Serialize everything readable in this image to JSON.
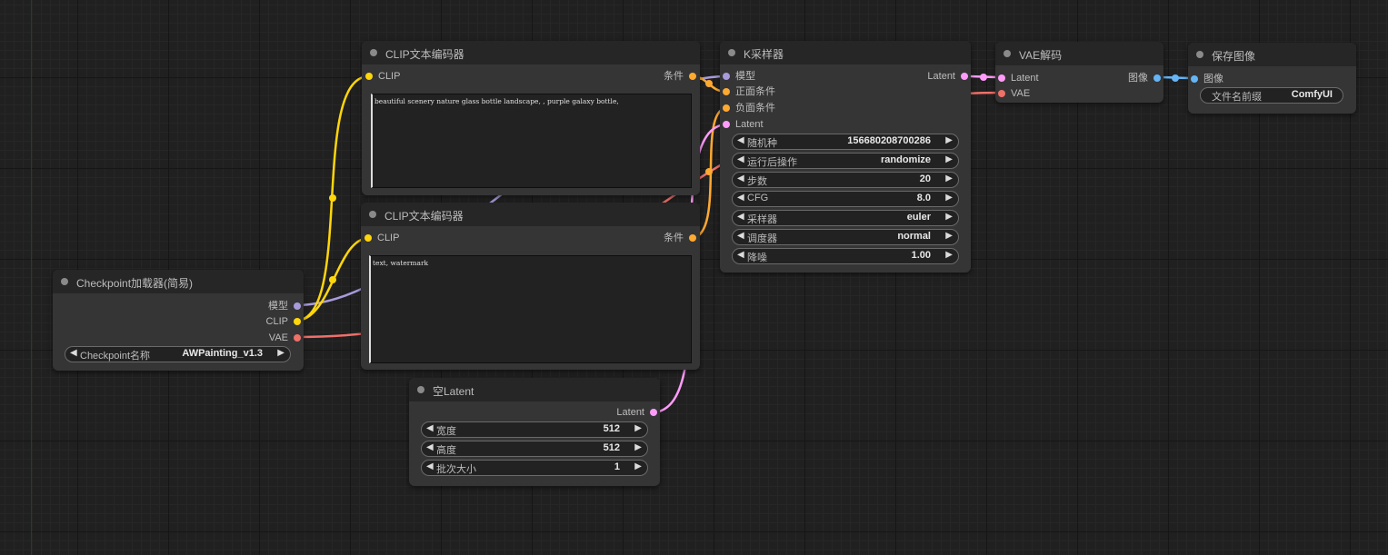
{
  "colors": {
    "model": "#a89bdb",
    "clip": "#ffd60a",
    "vae": "#f0706a",
    "conditioning": "#ffa931",
    "latent": "#ff9cf9",
    "image": "#64b5f6"
  },
  "icons": {
    "decrement": "◀",
    "increment": "▶"
  },
  "checkpoint_loader": {
    "title": "Checkpoint加载器(简易)",
    "outputs": {
      "model": "模型",
      "clip": "CLIP",
      "vae": "VAE"
    },
    "ckpt_name": {
      "label": "Checkpoint名称",
      "value": "AWPainting_v1.3"
    }
  },
  "clip_positive": {
    "title": "CLIP文本编码器",
    "input_clip": "CLIP",
    "output": "条件",
    "text": "beautiful scenery nature glass bottle landscape, , purple galaxy bottle,"
  },
  "clip_negative": {
    "title": "CLIP文本编码器",
    "input_clip": "CLIP",
    "output": "条件",
    "text": "text, watermark"
  },
  "empty_latent": {
    "title": "空Latent",
    "output": "Latent",
    "width": {
      "label": "宽度",
      "value": "512"
    },
    "height": {
      "label": "高度",
      "value": "512"
    },
    "batch": {
      "label": "批次大小",
      "value": "1"
    }
  },
  "ksampler": {
    "title": "K采样器",
    "inputs": {
      "model": "模型",
      "positive": "正面条件",
      "negative": "负面条件",
      "latent": "Latent"
    },
    "output": "Latent",
    "seed": {
      "label": "随机种",
      "value": "156680208700286"
    },
    "control": {
      "label": "运行后操作",
      "value": "randomize"
    },
    "steps": {
      "label": "步数",
      "value": "20"
    },
    "cfg": {
      "label": "CFG",
      "value": "8.0"
    },
    "sampler": {
      "label": "采样器",
      "value": "euler"
    },
    "scheduler": {
      "label": "调度器",
      "value": "normal"
    },
    "denoise": {
      "label": "降噪",
      "value": "1.00"
    }
  },
  "vae_decode": {
    "title": "VAE解码",
    "inputs": {
      "latent": "Latent",
      "vae": "VAE"
    },
    "output": "图像"
  },
  "save_image": {
    "title": "保存图像",
    "input_images": "图像",
    "prefix": {
      "label": "文件名前缀",
      "value": "ComfyUI"
    }
  }
}
